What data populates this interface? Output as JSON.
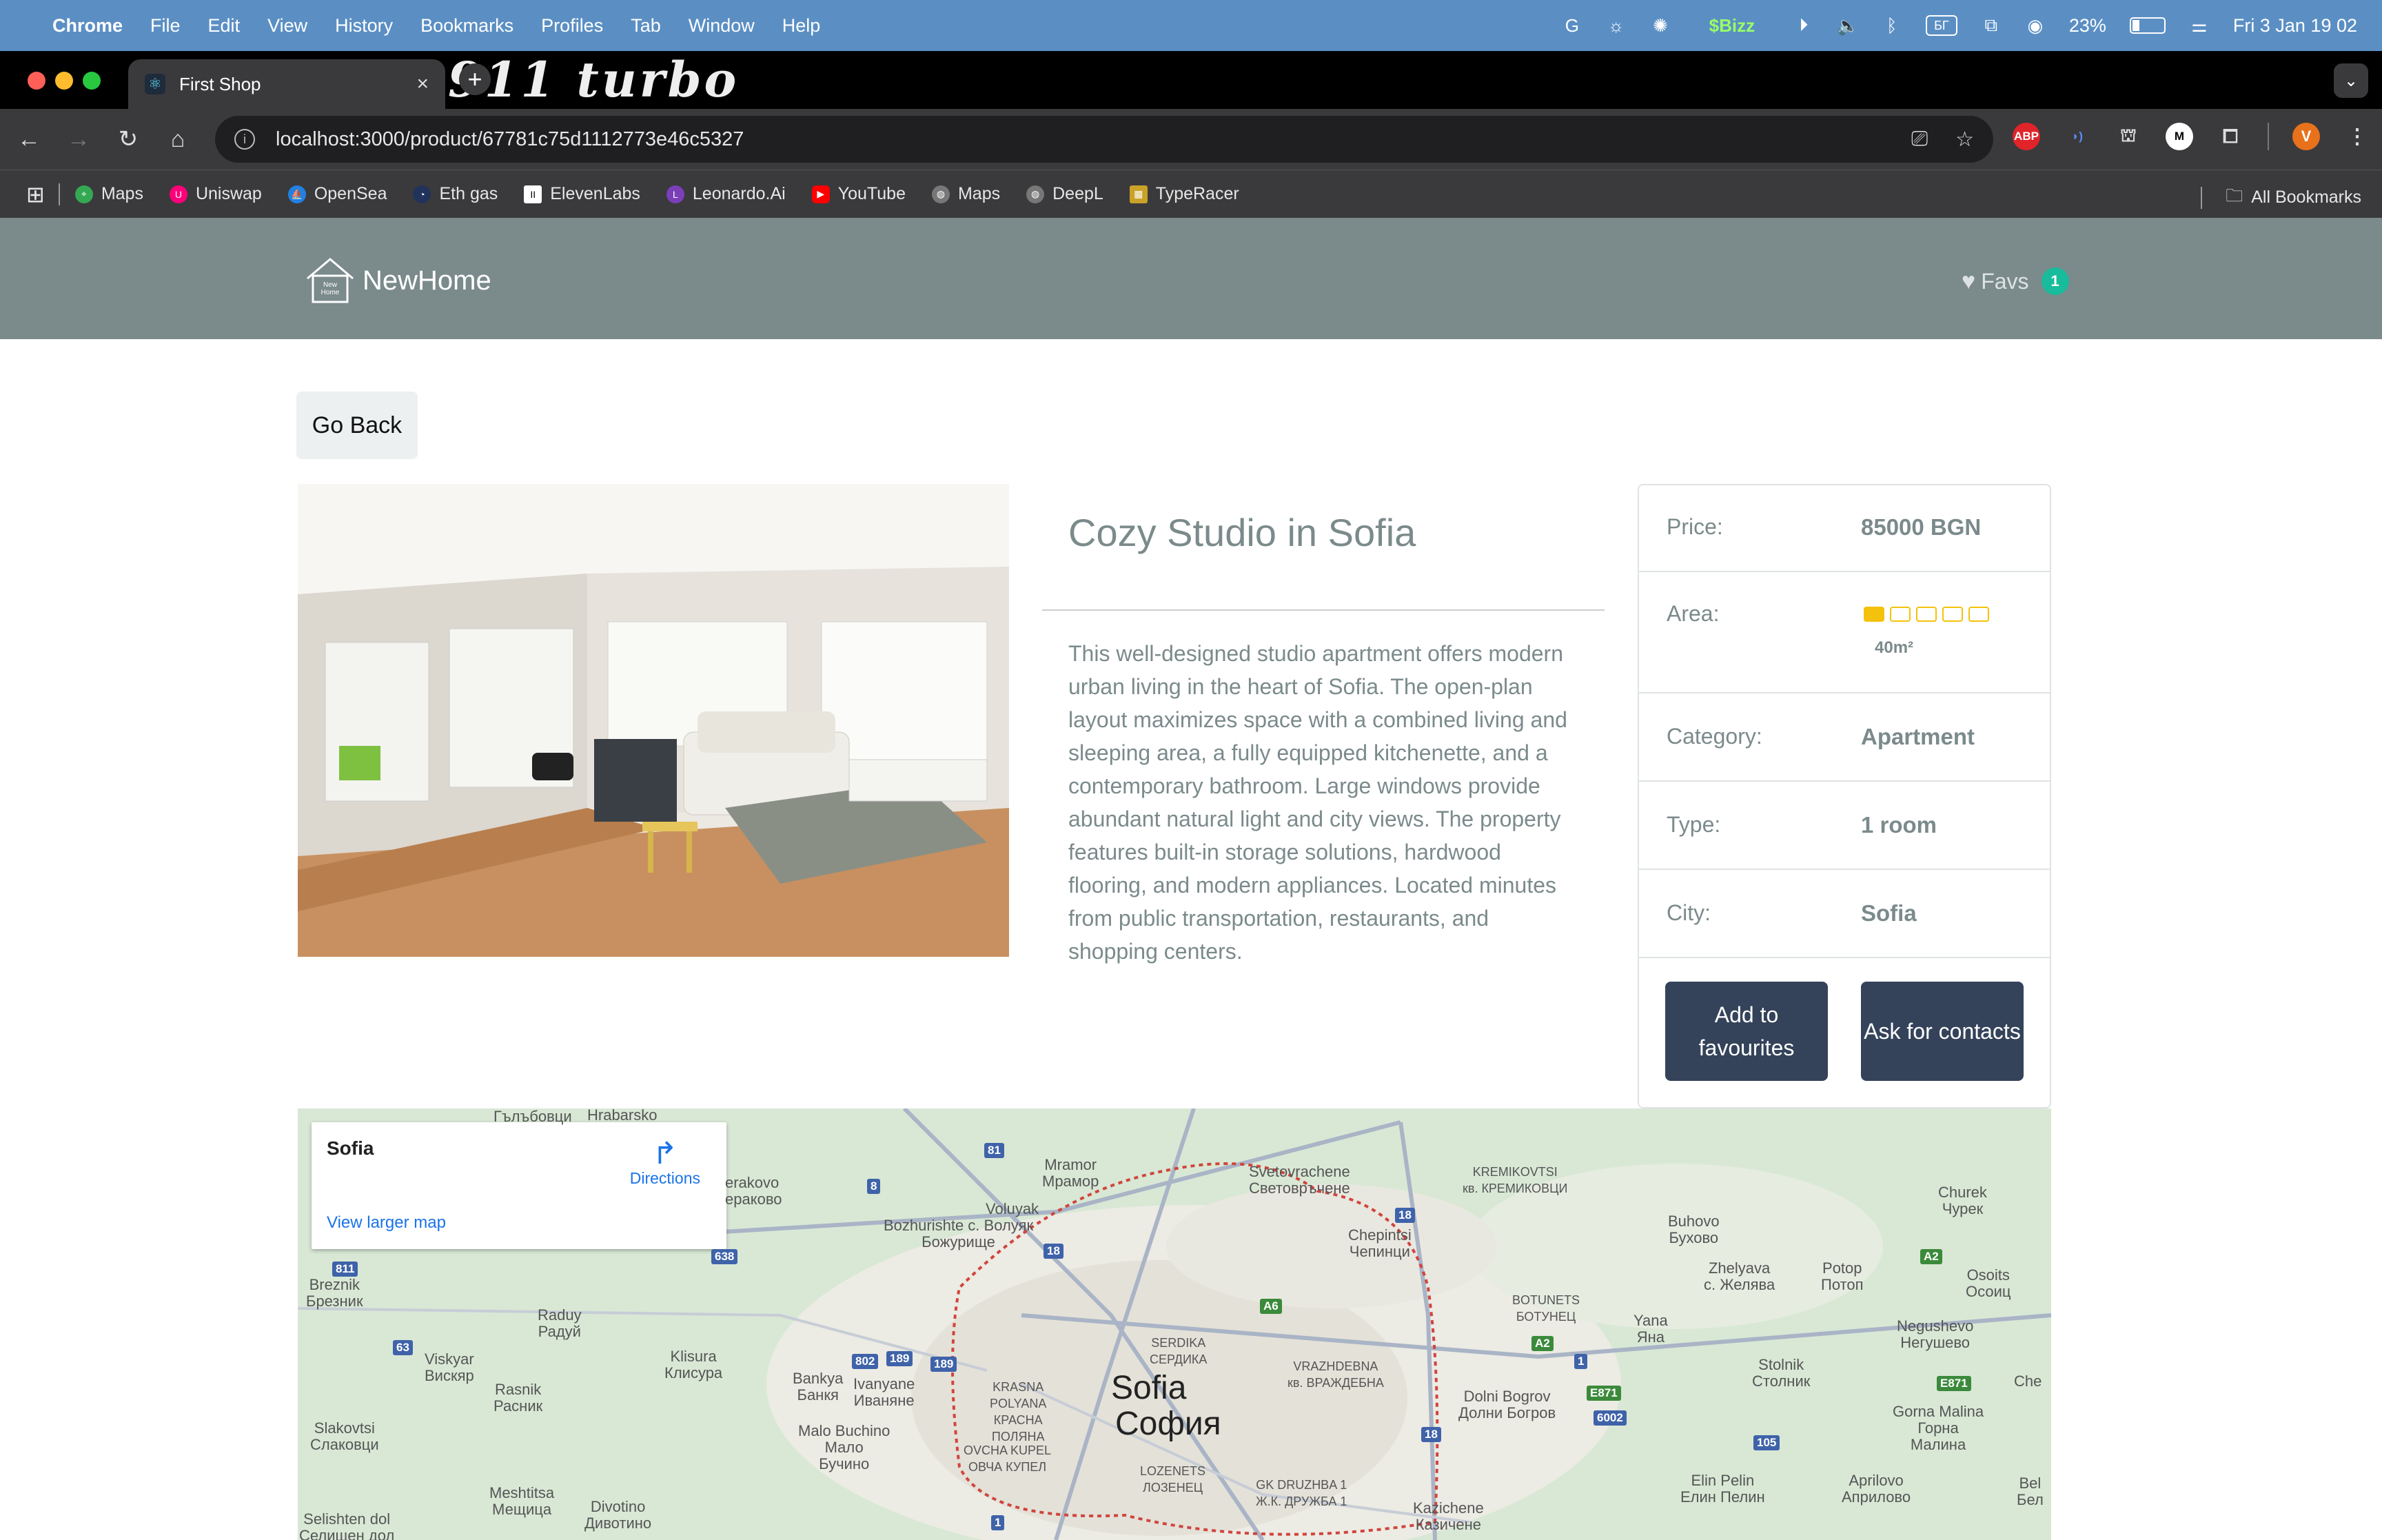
{
  "menubar": {
    "app": "Chrome",
    "items": [
      "File",
      "Edit",
      "View",
      "History",
      "Bookmarks",
      "Profiles",
      "Tab",
      "Window",
      "Help"
    ],
    "battery": "23%",
    "datetime": "Fri 3 Jan  19 02",
    "input_source": "БГ"
  },
  "browser": {
    "tab_title": "First Shop",
    "decoration_text": "911 turbo",
    "url": "localhost:3000/product/67781c75d1112773e46c5327",
    "profile_initial": "V",
    "bookmarks": [
      "Maps",
      "Uniswap",
      "OpenSea",
      "Eth gas",
      "ElevenLabs",
      "Leonardo.Ai",
      "YouTube",
      "Maps",
      "DeepL",
      "TypeRacer"
    ],
    "all_bookmarks": "All Bookmarks"
  },
  "site": {
    "brand": "NewHome",
    "logo_text_line1": "New",
    "logo_text_line2": "Home",
    "favs_label": "Favs",
    "favs_count": "1"
  },
  "product": {
    "go_back": "Go Back",
    "title": "Cozy Studio in Sofia",
    "description": "This well-designed studio apartment offers modern urban living in the heart of Sofia. The open-plan layout maximizes space with a combined living and sleeping area, a fully equipped kitchenette, and a contemporary bathroom. Large windows provide abundant natural light and city views. The property features built-in storage solutions, hardwood flooring, and modern appliances. Located minutes from public transportation, restaurants, and shopping centers.",
    "details": {
      "price_label": "Price:",
      "price_value": "85000 BGN",
      "area_label": "Area:",
      "area_value": "40m²",
      "area_rating_filled": 1,
      "area_rating_total": 5,
      "category_label": "Category:",
      "category_value": "Apartment",
      "type_label": "Type:",
      "type_value": "1 room",
      "city_label": "City:",
      "city_value": "Sofia"
    },
    "add_fav": "Add to favourites",
    "ask_contacts": "Ask for contacts"
  },
  "map": {
    "place": "Sofia",
    "directions": "Directions",
    "view_larger": "View larger map",
    "labels": {
      "city_latin": "Sofia",
      "city_cyr": "София",
      "hrabarsko": "Hrabarsko",
      "galabovtsi": "Гълъбовци",
      "mramor": "Mramor\nМрамор",
      "svetovrachene": "Svetovrachene\nСветовръчене",
      "kremikovtsi": "KREMIKOVTSI\nкв. КРЕМИКОВЦИ",
      "churek": "Churek\nЧурек",
      "buhovo": "Buhovo\nБухово",
      "voluyak": "Voluyak",
      "bozhurishte": "Bozhurishte с. Волуяк\nБожурище",
      "chepintsi": "Chepintsi\nЧепинци",
      "zhelyava": "Zhelyava\nс. Желява",
      "potop": "Potop\nПотоп",
      "breznik": "Breznik\nБрезник",
      "raduy": "Raduy\nРадуй",
      "botunets": "BOTUNETS\nБОТУНЕЦ",
      "yana": "Yana\nЯна",
      "negushevo": "Negushevo\nНегушево",
      "viskyar": "Viskyar\nВискяр",
      "klisura": "Klisura\nКлисура",
      "serdika": "SERDIKA\nСЕРДИКА",
      "vrazhdebna": "VRAZHDEBNA\nкв. ВРАЖДЕБНА",
      "stolnik": "Stolnik\nСтолник",
      "rasnik": "Rasnik\nРасник",
      "bankya": "Bankya\nБанкя",
      "ivanyane": "Ivanyane\nИваняне",
      "krasna_polyana": "KRASNA\nPOLYANA\nКРАСНА\nПОЛЯНА",
      "dolni_bogrov": "Dolni Bogrov\nДолни Богров",
      "gorna_malina": "Gorna Malina\nГорна\nМалина",
      "slakovtsi": "Slakovtsi\nСлаковци",
      "malo_buchino": "Malo Buchino\nМало\nБучино",
      "ovcha_kupel": "OVCHA KUPEL\nОВЧА КУПЕЛ",
      "lozenets": "LOZENETS\nЛОЗЕНЕЦ",
      "druzhba": "GK DRUZHBA 1\nЖ.К. ДРУЖБА 1",
      "meshtitsa": "Meshtitsa\nМещица",
      "divotino": "Divotino\nДивотино",
      "elin_pelin": "Elin Pelin\nЕлин Пелин",
      "aprilovo": "Aprilovo\nАприлово",
      "kazichene": "Kazichene\nКазичене",
      "selishten_dol": "Selishten dol\nСелищен дол",
      "erakovo": "erakovo\nераково",
      "osoitsa": "Osoits\nОсоиц",
      "bel": "Bel\nБел",
      "che": "Che"
    }
  },
  "colors": {
    "navbar": "#7b8a8b",
    "badge": "#18bc9c",
    "button": "#34435a",
    "star": "#f4c20d"
  }
}
